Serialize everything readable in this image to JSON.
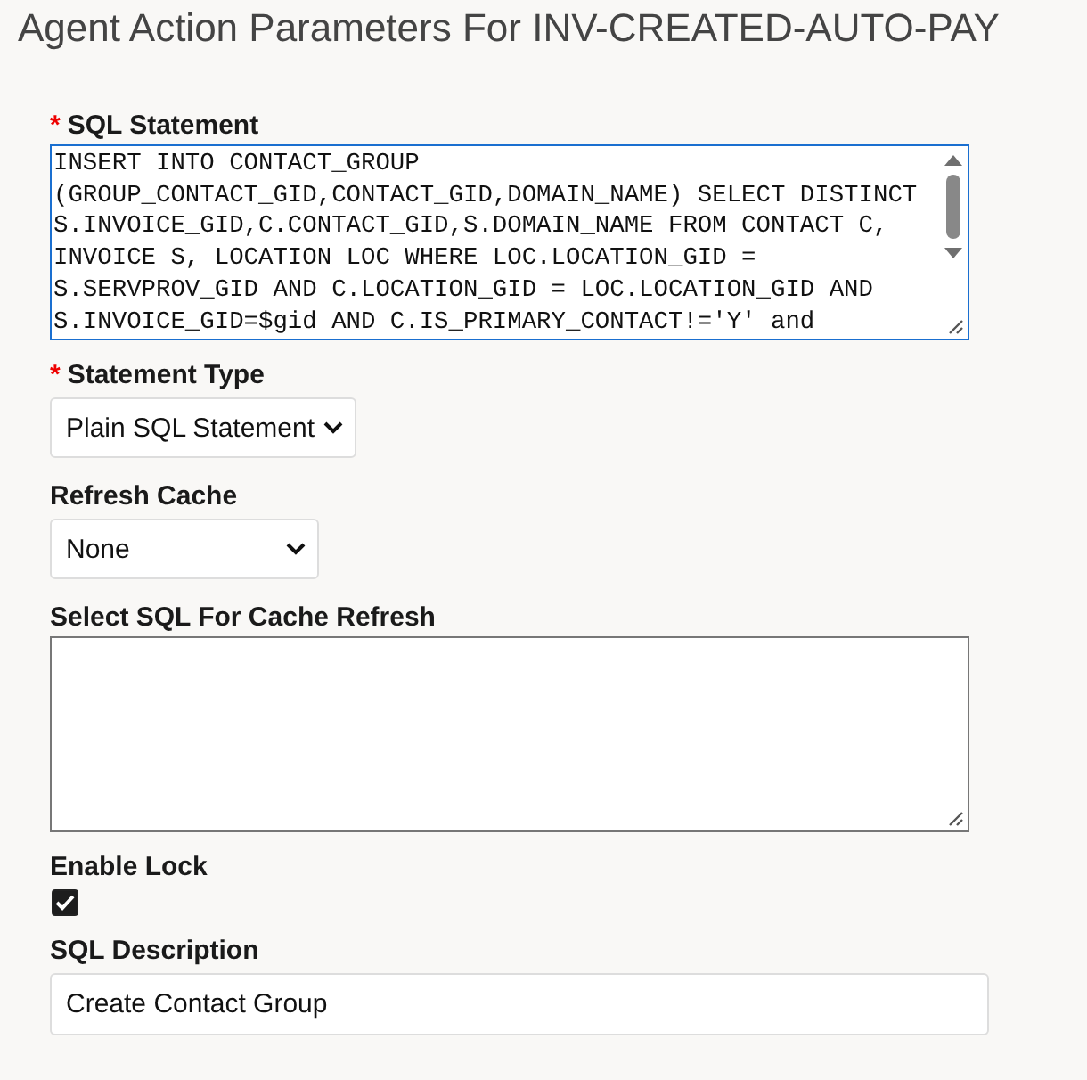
{
  "title": "Agent Action Parameters For INV-CREATED-AUTO-PAY",
  "fields": [
    {
      "kind": "code",
      "required_mark": "*",
      "label": "SQL Statement",
      "lines": [
        "INSERT INTO CONTACT_GROUP",
        "(GROUP_CONTACT_GID,CONTACT_GID,DOMAIN_NAME) SELECT DISTINCT",
        "S.INVOICE_GID,C.CONTACT_GID,S.DOMAIN_NAME FROM CONTACT C,",
        "INVOICE S, LOCATION LOC WHERE LOC.LOCATION_GID =",
        "S.SERVPROV_GID AND C.LOCATION_GID = LOC.LOCATION_GID AND",
        "S.INVOICE_GID=$gid AND C.IS_PRIMARY_CONTACT!='Y' and"
      ]
    },
    {
      "kind": "select",
      "required_mark": "*",
      "label": "Statement Type",
      "value": "Plain SQL Statement"
    },
    {
      "kind": "select",
      "label": "Refresh Cache",
      "value": "None"
    },
    {
      "kind": "code",
      "label": "Select SQL For Cache Refresh"
    },
    {
      "kind": "checkbox",
      "label": "Enable Lock",
      "checked": true
    },
    {
      "kind": "input",
      "label": "SQL Description",
      "value": "Create Contact Group"
    }
  ]
}
